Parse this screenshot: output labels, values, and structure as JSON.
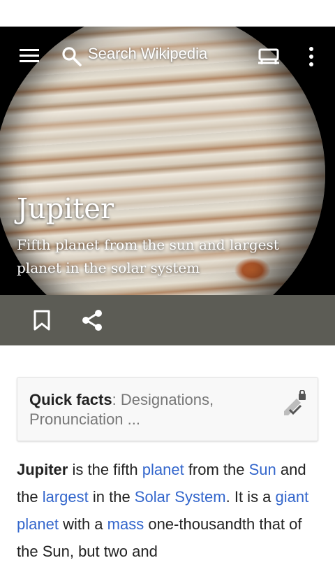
{
  "toolbar": {
    "search_placeholder": "Search Wikipedia"
  },
  "header": {
    "title": "Jupiter",
    "subtitle": "Fifth planet from the sun and largest planet in the solar system"
  },
  "quick_facts": {
    "label": "Quick facts",
    "separator": ": ",
    "items": "Designations, Pronunciation ..."
  },
  "article": {
    "segments": [
      {
        "text": "Jupiter",
        "type": "bold"
      },
      {
        "text": " is the fifth ",
        "type": "text"
      },
      {
        "text": "planet",
        "type": "link"
      },
      {
        "text": " from the ",
        "type": "text"
      },
      {
        "text": "Sun",
        "type": "link"
      },
      {
        "text": " and the ",
        "type": "text"
      },
      {
        "text": "largest",
        "type": "link"
      },
      {
        "text": " in the ",
        "type": "text"
      },
      {
        "text": "Solar System",
        "type": "link"
      },
      {
        "text": ". It is a ",
        "type": "text"
      },
      {
        "text": "giant planet",
        "type": "link"
      },
      {
        "text": " with a ",
        "type": "text"
      },
      {
        "text": "mass",
        "type": "link"
      },
      {
        "text": " one-thousandth that of the Sun, but two and",
        "type": "text"
      }
    ]
  },
  "colors": {
    "link": "#3366cc",
    "action_bar": "#5c5c55",
    "progress": "#33a0d8"
  },
  "icons": [
    "menu-icon",
    "search-icon",
    "reading-list-icon",
    "overflow-menu-icon",
    "bookmark-icon",
    "share-icon",
    "edit-lock-icon"
  ]
}
